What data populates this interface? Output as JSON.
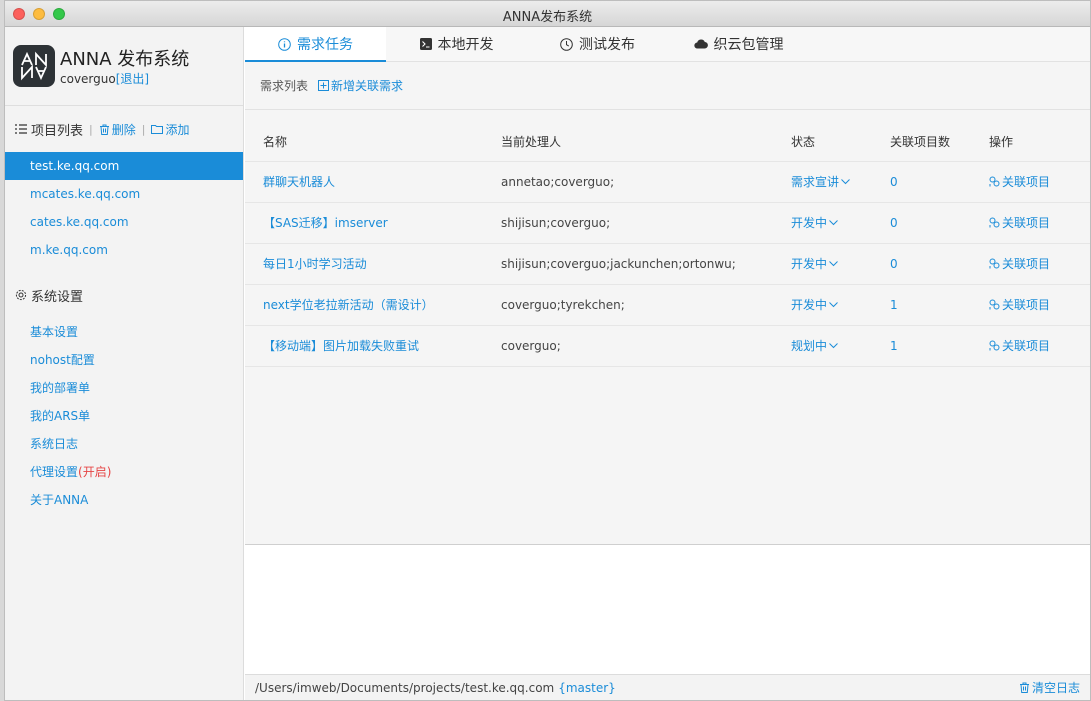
{
  "window": {
    "title": "ANNA发布系统"
  },
  "brand": {
    "title": "ANNA 发布系统",
    "user": "coverguo",
    "logout": "[退出]"
  },
  "projects": {
    "heading": "项目列表",
    "delete_label": "删除",
    "add_label": "添加",
    "items": [
      "test.ke.qq.com",
      "mcates.ke.qq.com",
      "cates.ke.qq.com",
      "m.ke.qq.com"
    ]
  },
  "settings": {
    "heading": "系统设置",
    "items": [
      "基本设置",
      "nohost配置",
      "我的部署单",
      "我的ARS单",
      "系统日志",
      "代理设置",
      "关于ANNA"
    ],
    "proxy_state": "(开启)"
  },
  "tabs": [
    "需求任务",
    "本地开发",
    "测试发布",
    "织云包管理"
  ],
  "requirements": {
    "list_label": "需求列表",
    "add_label": "新增关联需求",
    "columns": [
      "名称",
      "当前处理人",
      "状态",
      "关联项目数",
      "操作"
    ],
    "rows": [
      {
        "name": "群聊天机器人",
        "handler": "annetao;coverguo;",
        "status": "需求宣讲",
        "count": "0",
        "action": "关联项目"
      },
      {
        "name": "【SAS迁移】imserver",
        "handler": "shijisun;coverguo;",
        "status": "开发中",
        "count": "0",
        "action": "关联项目"
      },
      {
        "name": "每日1小时学习活动",
        "handler": "shijisun;coverguo;jackunchen;ortonwu;",
        "status": "开发中",
        "count": "0",
        "action": "关联项目"
      },
      {
        "name": "next学位老拉新活动（需设计）",
        "handler": "coverguo;tyrekchen;",
        "status": "开发中",
        "count": "1",
        "action": "关联项目"
      },
      {
        "name": "【移动端】图片加载失败重试",
        "handler": "coverguo;",
        "status": "规划中",
        "count": "1",
        "action": "关联项目"
      }
    ]
  },
  "footer": {
    "path": "/Users/imweb/Documents/projects/test.ke.qq.com",
    "branch": "{master}",
    "clear_label": "清空日志"
  },
  "colors": {
    "accent": "#1a8cd8",
    "active_bg": "#1a8cd8",
    "warning": "#e64545"
  }
}
